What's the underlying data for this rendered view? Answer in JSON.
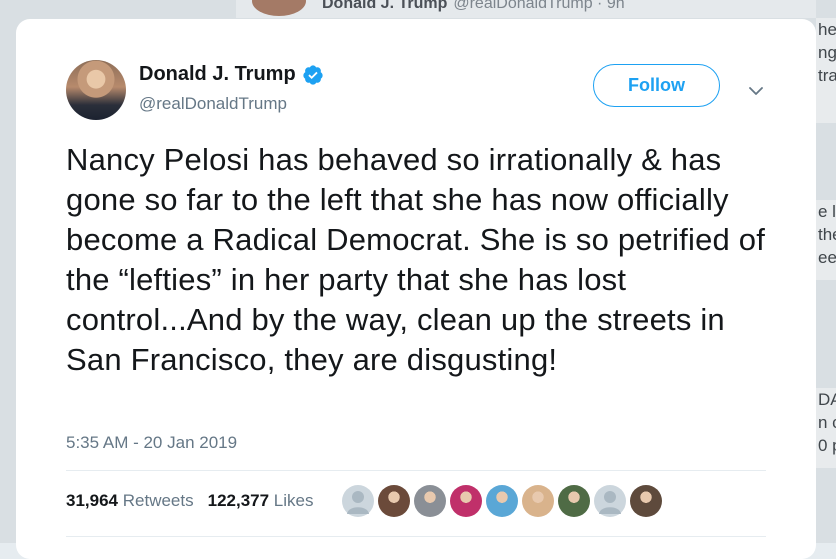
{
  "background": {
    "author_name": "Donald J. Trump",
    "author_handle": "@realDonaldTrump · 9h",
    "strip1": [
      "hen",
      "ng",
      "tra"
    ],
    "strip2": [
      "e le",
      "the",
      "eet"
    ],
    "strip3": [
      "DA",
      "n c",
      "0 p"
    ]
  },
  "tweet": {
    "author_name": "Donald J. Trump",
    "author_handle": "@realDonaldTrump",
    "follow_label": "Follow",
    "text": "Nancy Pelosi has behaved so irrationally & has gone so far to the left that she has now officially become a Radical Democrat. She is so petrified of the “lefties” in her party that she has lost control...And by the way, clean up the streets in San Francisco, they are disgusting!",
    "timestamp": "5:35 AM - 20 Jan 2019",
    "retweets_count": "31,964",
    "retweets_label": "Retweets",
    "likes_count": "122,377",
    "likes_label": "Likes"
  },
  "likers": [
    {
      "icon": "default-avatar",
      "color": "#aab8c2"
    },
    {
      "icon": "user-avatar",
      "color": "#6b4a3a"
    },
    {
      "icon": "user-avatar",
      "color": "#8a8f96"
    },
    {
      "icon": "user-avatar",
      "color": "#c0306a"
    },
    {
      "icon": "user-avatar",
      "color": "#5aa7d6"
    },
    {
      "icon": "user-avatar",
      "color": "#d9b38c"
    },
    {
      "icon": "user-avatar",
      "color": "#4f6b45"
    },
    {
      "icon": "default-avatar",
      "color": "#aab8c2"
    },
    {
      "icon": "user-avatar",
      "color": "#5e4a3c"
    }
  ],
  "colors": {
    "accent": "#1da1f2",
    "text": "#14171a",
    "muted": "#657786"
  }
}
